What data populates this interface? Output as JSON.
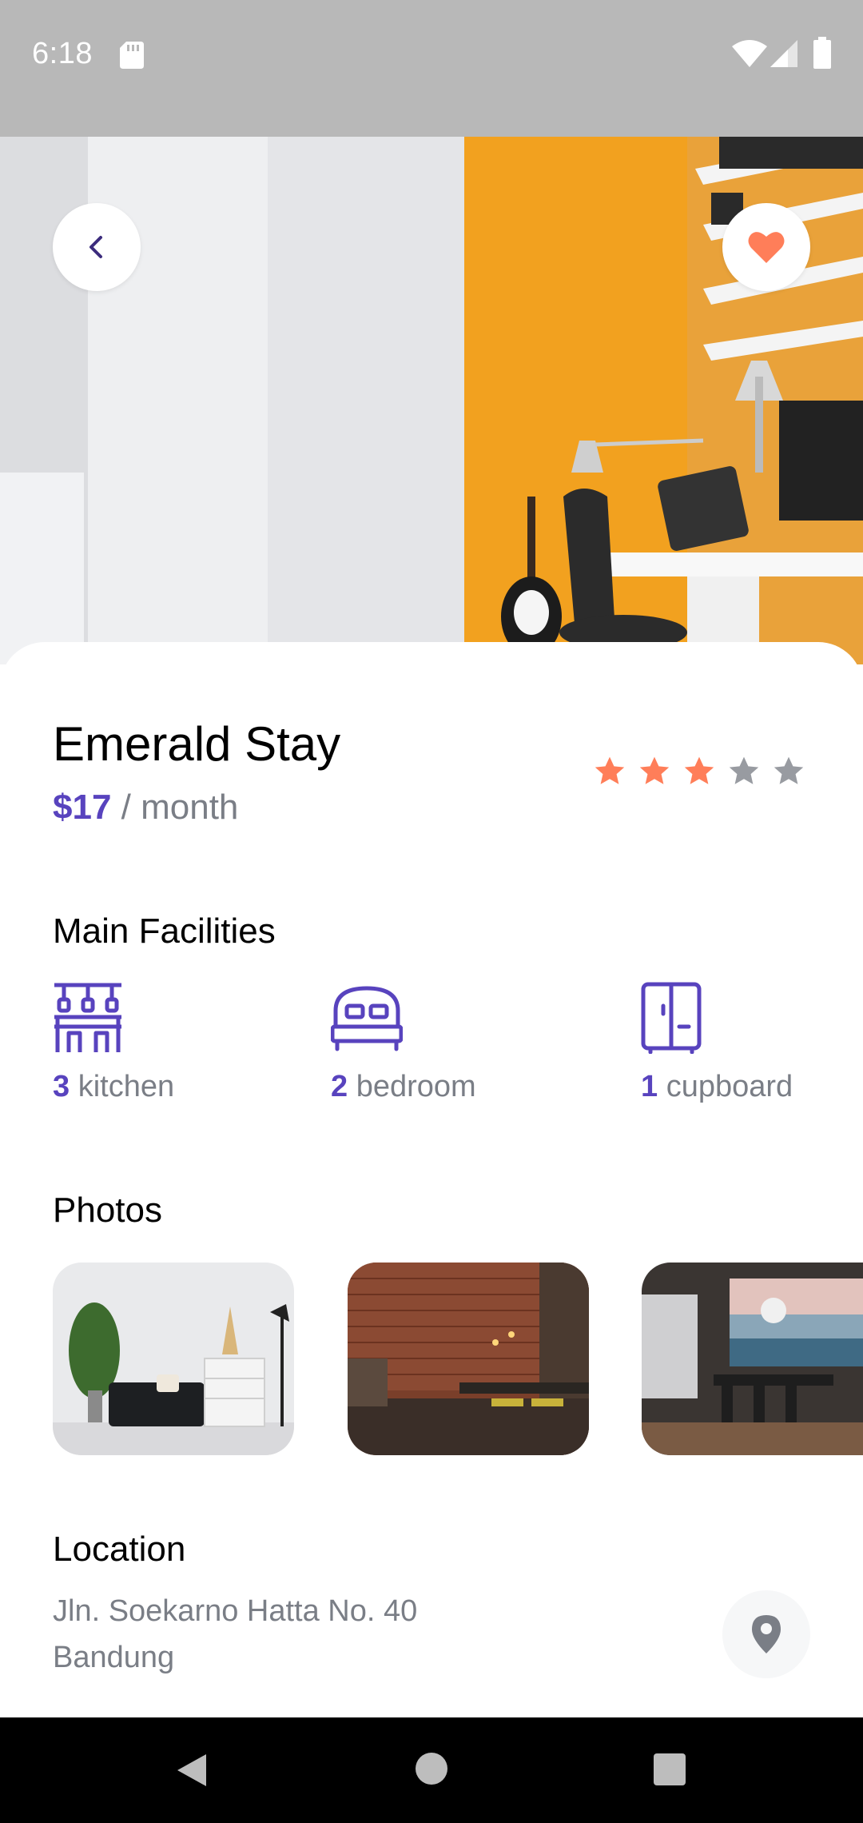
{
  "status_bar": {
    "time": "6:18",
    "icons": [
      "sd-card-icon",
      "wifi-icon",
      "signal-icon",
      "battery-icon"
    ]
  },
  "header": {
    "back_icon": "chevron-left-icon",
    "favorite_icon": "heart-icon",
    "favorite_color": "#ff7e59"
  },
  "listing": {
    "name": "Emerald Stay",
    "price": "$17",
    "price_period": " / month",
    "rating": 3,
    "rating_max": 5
  },
  "facilities": {
    "title": "Main Facilities",
    "items": [
      {
        "count": "3",
        "label": " kitchen",
        "icon": "kitchen-icon"
      },
      {
        "count": "2",
        "label": " bedroom",
        "icon": "bed-icon"
      },
      {
        "count": "1",
        "label": " cupboard",
        "icon": "cupboard-icon"
      }
    ]
  },
  "photos": {
    "title": "Photos",
    "items": [
      "living-room-photo",
      "brick-dining-photo",
      "sea-view-dining-photo"
    ]
  },
  "location": {
    "title": "Location",
    "address_line1": "Jln. Soekarno Hatta No. 40",
    "address_line2": "Bandung",
    "map_icon": "map-pin-icon"
  },
  "colors": {
    "accent": "#5843be",
    "star_active": "#ff7e59",
    "star_inactive": "#989ba1",
    "muted_text": "#7a7e86"
  },
  "nav_bar": {
    "icons": [
      "nav-back-icon",
      "nav-home-icon",
      "nav-recents-icon"
    ]
  }
}
